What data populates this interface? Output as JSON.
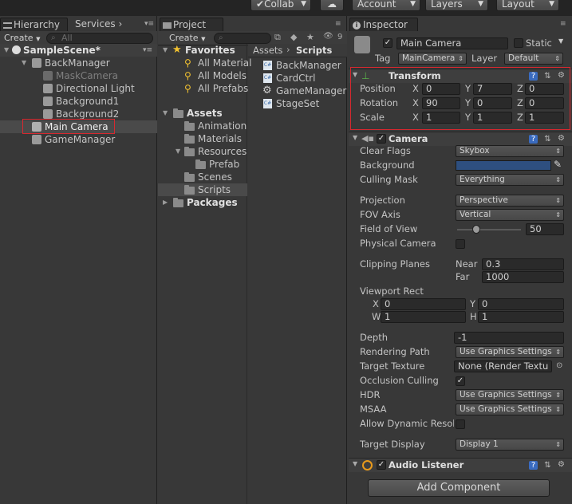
{
  "topbar": {
    "collab": "Collab",
    "account": "Account",
    "layers": "Layers",
    "layout": "Layout"
  },
  "hierarchy": {
    "tab": "Hierarchy",
    "services_tab": "Services",
    "create": "Create",
    "search_placeholder": "All",
    "scene": "SampleScene*",
    "items": [
      "BackManager",
      "MaskCamera",
      "Directional Light",
      "Background1",
      "Background2",
      "Main Camera",
      "GameManager"
    ]
  },
  "project": {
    "tab": "Project",
    "create": "Create",
    "favorites": "Favorites",
    "fav_items": [
      "All Material",
      "All Models",
      "All Prefabs"
    ],
    "assets": "Assets",
    "folders": [
      "Animation",
      "Materials",
      "Resources",
      "Prefab",
      "Scenes",
      "Scripts"
    ],
    "packages": "Packages",
    "count": "9",
    "breadcrumb": [
      "Assets",
      "Scripts"
    ],
    "files": [
      "BackManager",
      "CardCtrl",
      "GameManager",
      "StageSet"
    ]
  },
  "inspector": {
    "tab": "Inspector",
    "object_name": "Main Camera",
    "static": "Static",
    "tag_label": "Tag",
    "tag_value": "MainCamera",
    "layer_label": "Layer",
    "layer_value": "Default",
    "transform": {
      "title": "Transform",
      "rows": [
        {
          "label": "Position",
          "x": "0",
          "y": "7",
          "z": "0"
        },
        {
          "label": "Rotation",
          "x": "90",
          "y": "0",
          "z": "0"
        },
        {
          "label": "Scale",
          "x": "1",
          "y": "1",
          "z": "1"
        }
      ],
      "axis": [
        "X",
        "Y",
        "Z"
      ]
    },
    "camera": {
      "title": "Camera",
      "clear_flags": {
        "label": "Clear Flags",
        "value": "Skybox"
      },
      "background": {
        "label": "Background",
        "color": "#2e4f7f"
      },
      "culling_mask": {
        "label": "Culling Mask",
        "value": "Everything"
      },
      "projection": {
        "label": "Projection",
        "value": "Perspective"
      },
      "fov_axis": {
        "label": "FOV Axis",
        "value": "Vertical"
      },
      "field_of_view": {
        "label": "Field of View",
        "value": "50",
        "fraction": 0.3
      },
      "physical_camera": {
        "label": "Physical Camera"
      },
      "clipping": {
        "label": "Clipping Planes",
        "near_label": "Near",
        "near": "0.3",
        "far_label": "Far",
        "far": "1000"
      },
      "viewport": {
        "label": "Viewport Rect",
        "x_label": "X",
        "x": "0",
        "y_label": "Y",
        "y": "0",
        "w_label": "W",
        "w": "1",
        "h_label": "H",
        "h": "1"
      },
      "depth": {
        "label": "Depth",
        "value": "-1"
      },
      "rendering_path": {
        "label": "Rendering Path",
        "value": "Use Graphics Settings"
      },
      "target_texture": {
        "label": "Target Texture",
        "value": "None (Render Textu"
      },
      "occlusion": {
        "label": "Occlusion Culling"
      },
      "hdr": {
        "label": "HDR",
        "value": "Use Graphics Settings"
      },
      "msaa": {
        "label": "MSAA",
        "value": "Use Graphics Settings"
      },
      "dynamic_res": {
        "label": "Allow Dynamic Resol"
      },
      "target_display": {
        "label": "Target Display",
        "value": "Display 1"
      }
    },
    "audio_listener": "Audio Listener",
    "add_component": "Add Component"
  },
  "colors": {
    "highlight": "#d7282f",
    "selection": "#4a4a4a",
    "accent": "#3d6ea8"
  }
}
